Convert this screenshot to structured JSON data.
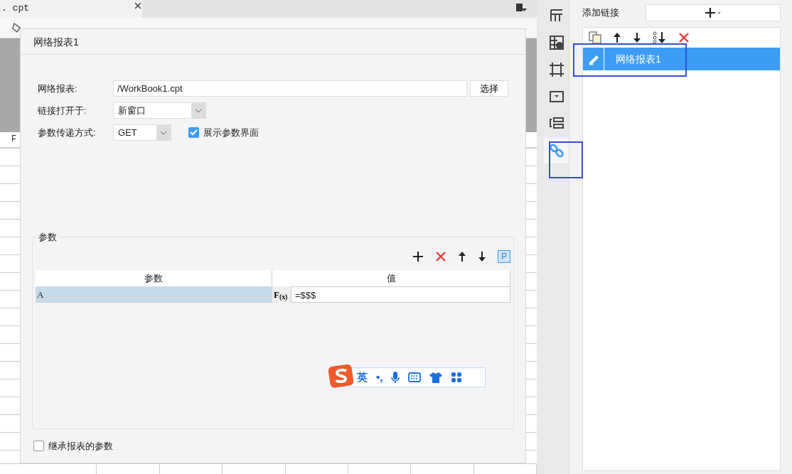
{
  "editor_tab": {
    "title": ". cpt"
  },
  "grid": {
    "column_header": "F"
  },
  "dialog": {
    "title": "网络报表1",
    "fields": [
      {
        "kind": "text",
        "label": "网络报表:",
        "value": "/WorkBook1.cpt",
        "button": "选择"
      },
      {
        "kind": "select",
        "label": "链接打开于:",
        "value": "新窗口"
      },
      {
        "kind": "select",
        "label": "参数传递方式:",
        "value": "GET",
        "checkbox": {
          "label": "展示参数界面",
          "checked": true
        }
      }
    ],
    "params": {
      "title": "参数",
      "toolbar_button": "P",
      "columns": [
        "参数",
        "值"
      ],
      "rows": [
        {
          "name": "A",
          "formula_button": "F$_{(x)}$",
          "value": "=$$$",
          "selected": true
        }
      ]
    },
    "inherit": {
      "label": "继承报表的参数",
      "checked": false
    }
  },
  "ime_bar": {
    "mode": "英",
    "punctuation": "•,"
  },
  "side_tabs": [
    {
      "selected": false
    },
    {
      "selected": false
    },
    {
      "selected": false
    },
    {
      "selected": false
    },
    {
      "selected": false
    },
    {
      "selected": true
    }
  ],
  "link_panel": {
    "label": "添加链接",
    "items": [
      {
        "name": "网络报表1",
        "selected": true
      }
    ]
  }
}
